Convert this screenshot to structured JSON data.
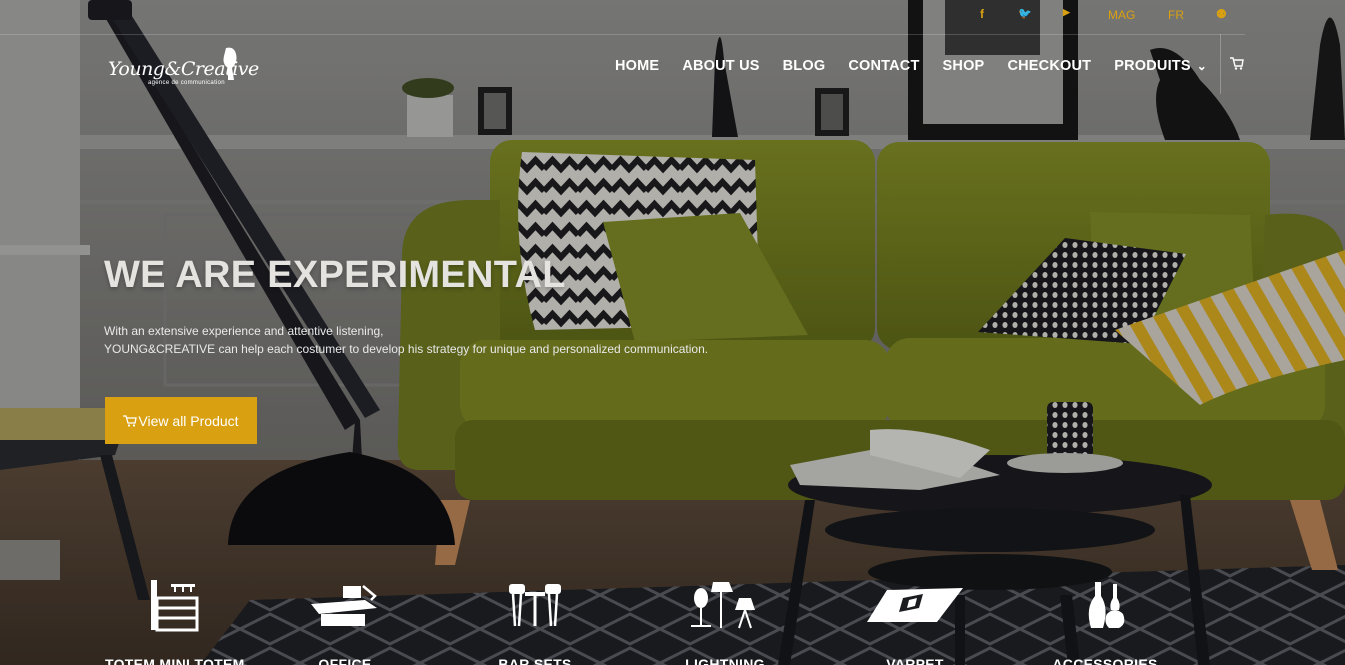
{
  "topbar": {
    "facebook_icon": "f",
    "twitter_icon": "t",
    "youtube_icon": "You",
    "lang_mag": "MAG",
    "lang_fr": "FR"
  },
  "logo": {
    "name": "Young&Creative",
    "tagline": "agence de communication"
  },
  "nav": {
    "items": [
      "HOME",
      "ABOUT US",
      "BLOG",
      "CONTACT",
      "SHOP",
      "CHECKOUT",
      "PRODUITS"
    ]
  },
  "hero": {
    "title": "WE ARE EXPERIMENTAL",
    "desc_line1": "With an extensive experience and attentive listening,",
    "desc_line2": "YOUNG&CREATIVE can help each costumer to develop his strategy for unique and personalized communication.",
    "button_label": "View all Product"
  },
  "categories": [
    {
      "label": "TOTEM MINI TOTEM",
      "icon": "shelf-icon"
    },
    {
      "label": "OFFICE",
      "icon": "desk-icon"
    },
    {
      "label": "BAR SETS",
      "icon": "bar-set-icon"
    },
    {
      "label": "LIGHTNING",
      "icon": "lamp-icon"
    },
    {
      "label": "VARPET",
      "icon": "carpet-icon"
    },
    {
      "label": "ACCESSORIES",
      "icon": "vase-icon"
    }
  ],
  "colors": {
    "accent": "#d9a112",
    "text_light": "#ffffff"
  }
}
